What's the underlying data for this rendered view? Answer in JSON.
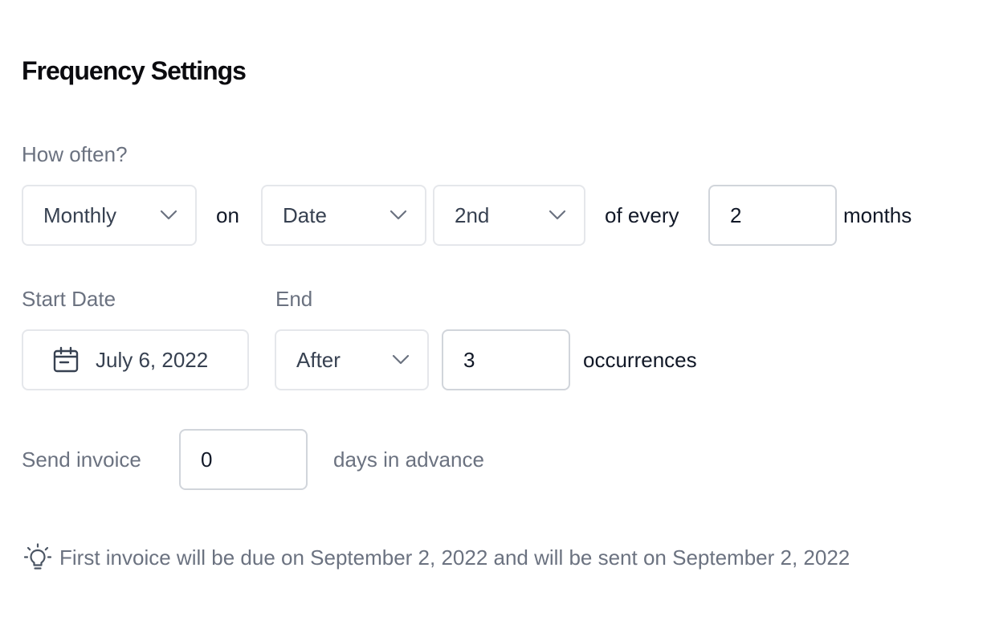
{
  "title": "Frequency Settings",
  "how_often": {
    "label": "How often?",
    "frequency_select": "Monthly",
    "on_text": "on",
    "day_type_select": "Date",
    "day_select": "2nd",
    "of_every_text": "of every",
    "interval_value": "2",
    "unit_text": "months"
  },
  "start_date": {
    "label": "Start Date",
    "value": "July 6, 2022",
    "icon": "calendar-icon"
  },
  "end": {
    "label": "End",
    "condition_select": "After",
    "occurrences_value": "3",
    "unit_text": "occurrences"
  },
  "send_invoice": {
    "label": "Send invoice",
    "days_value": "0",
    "suffix_text": "days in advance"
  },
  "hint": {
    "icon": "lightbulb-icon",
    "text": "First invoice will be due on September 2, 2022 and will be sent on September 2, 2022"
  },
  "colors": {
    "border": "#e5e7eb",
    "muted_text": "#6b7280",
    "text": "#111827"
  }
}
